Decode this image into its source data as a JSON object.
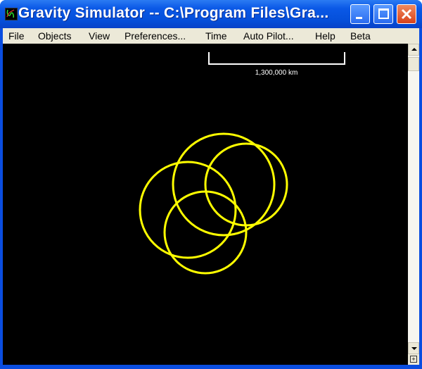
{
  "window": {
    "title": "Gravity Simulator -- C:\\Program Files\\Gra...",
    "controls": {
      "minimize": "minimize",
      "maximize": "maximize",
      "close": "close"
    }
  },
  "menu": [
    {
      "label": "File"
    },
    {
      "label": "Objects"
    },
    {
      "label": "View"
    },
    {
      "label": "Preferences..."
    },
    {
      "label": "Time"
    },
    {
      "label": "Auto Pilot..."
    },
    {
      "label": "Help"
    },
    {
      "label": "Beta"
    }
  ],
  "scale_bar": {
    "label": "1,300,000  km"
  },
  "orbits": {
    "color": "#ffff00",
    "count": 4
  },
  "colors": {
    "background": "#000000",
    "orbit": "#ffff00",
    "titlebar": "#0a58e6",
    "menubar": "#ece9d8"
  }
}
